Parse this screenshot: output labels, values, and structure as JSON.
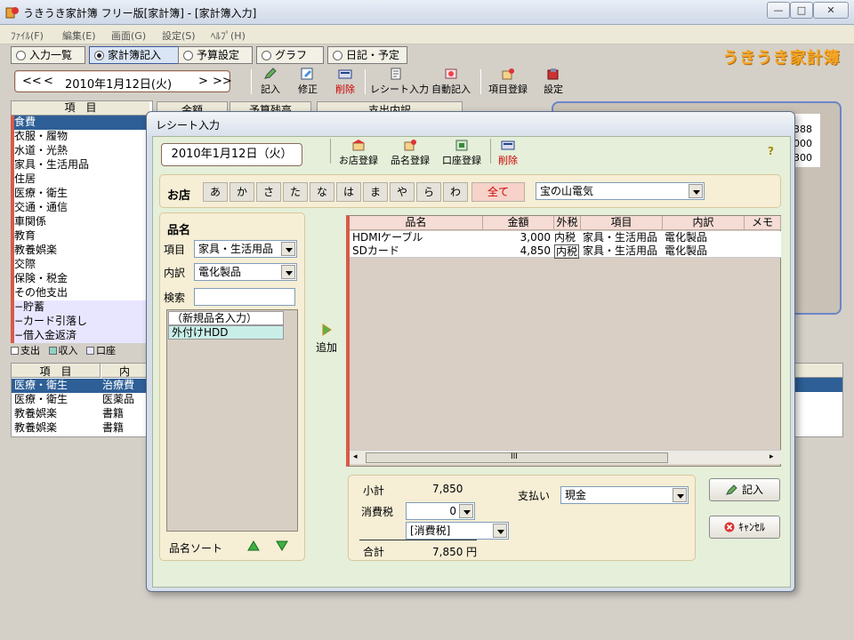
{
  "window": {
    "title": "うきうき家計簿 フリー版[家計簿] - [家計簿入力]",
    "controls": [
      "—",
      "□",
      "✕"
    ]
  },
  "menu": [
    "ﾌｧｲﾙ(F)",
    "編集(E)",
    "画面(G)",
    "設定(S)",
    "ﾍﾙﾌﾟ(H)"
  ],
  "tabs": [
    {
      "label": "入力一覧",
      "active": false
    },
    {
      "label": "家計簿記入",
      "active": true
    },
    {
      "label": "予算設定",
      "active": false
    },
    {
      "label": "グラフ",
      "active": false
    },
    {
      "label": "日記・予定",
      "active": false
    }
  ],
  "logo": "うきうき家計簿",
  "date_nav": {
    "prev_month": "<<",
    "prev_day": "<",
    "date": "2010年1月12日(火)",
    "next_day": ">",
    "next_month": ">>"
  },
  "toolbar": {
    "write": "記入",
    "edit": "修正",
    "delete": "削除",
    "receipt": "レシート入力",
    "auto": "自動記入",
    "item_reg": "項目登録",
    "settings": "設定"
  },
  "background": {
    "grid_header": "項　目",
    "grid_col2": "金額",
    "grid_col3": "予算残高",
    "grid_col4": "支出内訳",
    "categories": [
      {
        "label": "食費",
        "selected": true
      },
      {
        "label": "衣服・履物"
      },
      {
        "label": "水道・光熱"
      },
      {
        "label": "家具・生活用品"
      },
      {
        "label": "住居"
      },
      {
        "label": "医療・衛生"
      },
      {
        "label": "交通・通信"
      },
      {
        "label": "車関係"
      },
      {
        "label": "教育"
      },
      {
        "label": "教養娯楽"
      },
      {
        "label": "交際"
      },
      {
        "label": "保険・税金"
      },
      {
        "label": "その他支出"
      },
      {
        "label": "−貯蓄",
        "shade": true
      },
      {
        "label": "−カード引落し",
        "shade": true
      },
      {
        "label": "−借入金返済",
        "shade": true
      }
    ],
    "legend": [
      "支出",
      "収入",
      "口座"
    ],
    "bottom_grid_header": [
      "項　目",
      "内"
    ],
    "bottom_rows": [
      [
        "医療・衛生",
        "治療費"
      ],
      [
        "医療・衛生",
        "医薬品"
      ],
      [
        "教養娯楽",
        "書籍"
      ],
      [
        "教養娯楽",
        "書籍"
      ]
    ],
    "right_values": [
      "388",
      "000",
      "300"
    ]
  },
  "dialog": {
    "title": "レシート入力",
    "date": "2010年1月12日（火）",
    "toolbar": {
      "shop_reg": "お店登録",
      "item_reg": "品名登録",
      "account_reg": "口座登録",
      "delete": "削除"
    },
    "help": "?",
    "shop": {
      "label": "お店",
      "kana": [
        "あ",
        "か",
        "さ",
        "た",
        "な",
        "は",
        "ま",
        "や",
        "ら",
        "わ"
      ],
      "all": "全て",
      "selected_shop": "宝の山電気"
    },
    "item_panel": {
      "title": "品名",
      "category_label": "項目",
      "category_value": "家具・生活用品",
      "detail_label": "内訳",
      "detail_value": "電化製品",
      "search_label": "検索",
      "search_value": "",
      "list": [
        "（新規品名入力）",
        "外付けHDD"
      ],
      "sort_label": "品名ソート"
    },
    "add_label": "追加",
    "grid": {
      "headers": [
        "品名",
        "金額",
        "外税",
        "項目",
        "内訳",
        "メモ"
      ],
      "rows": [
        {
          "name": "HDMIケーブル",
          "amount": "3,000",
          "tax": "内税",
          "category": "家具・生活用品",
          "detail": "電化製品"
        },
        {
          "name": "SDカード",
          "amount": "4,850",
          "tax": "内税",
          "category": "家具・生活用品",
          "detail": "電化製品"
        }
      ],
      "scroll_grip": "III"
    },
    "summary": {
      "subtotal_label": "小計",
      "subtotal": "7,850",
      "tax_label": "消費税",
      "tax_value": "0",
      "tax_type": "[消費税]",
      "total_label": "合計",
      "total": "7,850 円",
      "payment_label": "支払い",
      "payment_value": "現金"
    },
    "buttons": {
      "write": "記入",
      "cancel": "ｷｬﾝｾﾙ"
    }
  },
  "colors": {
    "selected_row": "#2e5f96",
    "grid_accent": "#d85a48",
    "panel_bg": "#f6eed5",
    "dialog_bg": "#e5efd9"
  }
}
